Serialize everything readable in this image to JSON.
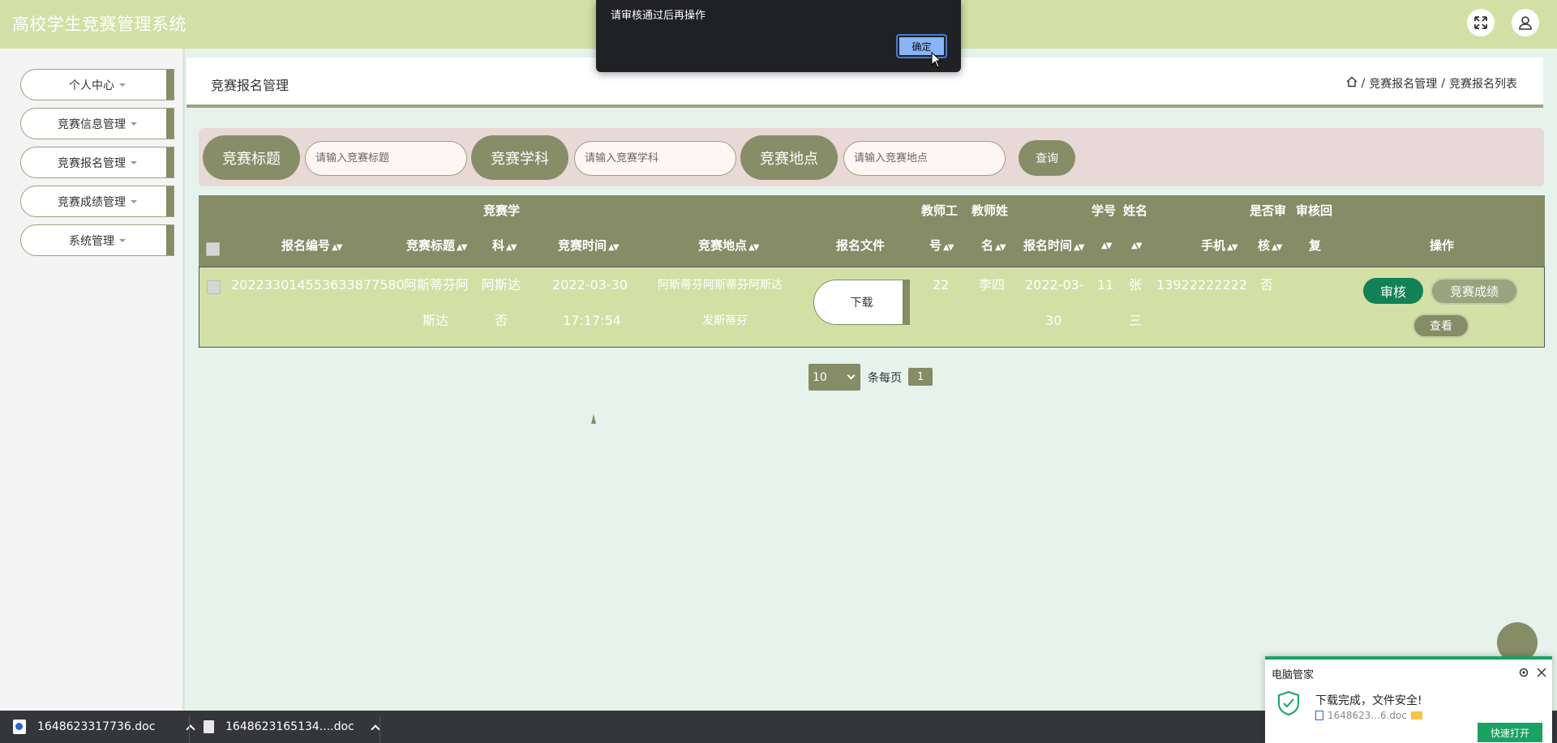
{
  "app": {
    "title": "高校学生竞赛管理系统"
  },
  "header": {
    "fullscreen_icon": "expand-icon",
    "user_icon": "user-icon"
  },
  "sidebar": {
    "items": [
      {
        "label": "个人中心"
      },
      {
        "label": "竞赛信息管理"
      },
      {
        "label": "竞赛报名管理"
      },
      {
        "label": "竞赛成绩管理"
      },
      {
        "label": "系统管理"
      }
    ]
  },
  "page": {
    "title": "竞赛报名管理",
    "breadcrumb": {
      "home_icon": "home-icon",
      "sep": "/",
      "level1": "竞赛报名管理",
      "level2": "竞赛报名列表"
    }
  },
  "search": {
    "title_label": "竞赛标题",
    "title_placeholder": "请输入竞赛标题",
    "subject_label": "竞赛学科",
    "subject_placeholder": "请输入竞赛学科",
    "location_label": "竞赛地点",
    "location_placeholder": "请输入竞赛地点",
    "query_button": "查询"
  },
  "table": {
    "headers": {
      "reg_no": "报名编号",
      "comp_title": "竞赛标题",
      "subject_line1": "竞赛学",
      "subject_line2": "科",
      "comp_time": "竞赛时间",
      "location": "竞赛地点",
      "file": "报名文件",
      "teacher_no_line1": "教师工",
      "teacher_no_line2": "号",
      "teacher_name_line1": "教师姓",
      "teacher_name_line2": "名",
      "reg_time": "报名时间",
      "student_no": "学号",
      "name": "姓名",
      "phone": "手机",
      "approved_line1": "是否审",
      "approved_line2": "核",
      "reply_line1": "审核回",
      "reply_line2": "复",
      "actions": "操作"
    },
    "rows": [
      {
        "reg_no": "20223301455363387758​0",
        "comp_title_1": "阿斯蒂芬阿",
        "comp_title_2": "斯达",
        "subject_1": "阿斯达",
        "subject_2": "否",
        "comp_time_1": "2022-03-30",
        "comp_time_2": "17:17:54",
        "location_1": "阿斯蒂芬阿斯蒂芬阿斯达",
        "location_2": "发斯蒂芬",
        "download": "下载",
        "teacher_no": "22",
        "teacher_name": "李四",
        "reg_time_1": "2022-03-",
        "reg_time_2": "30",
        "student_no": "11",
        "name_1": "张",
        "name_2": "三",
        "phone": "13922222222",
        "approved": "否",
        "reply": "",
        "btn_review": "审核",
        "btn_score": "竞赛成绩",
        "btn_view": "查看"
      }
    ]
  },
  "pagination": {
    "page_size": "10",
    "per_page_label": "条每页",
    "current_page": "1"
  },
  "alert": {
    "message": "请审核通过后再操作",
    "ok": "确定"
  },
  "downloads": [
    {
      "name": "1648623317736.doc"
    },
    {
      "name": "1648623165134....doc"
    }
  ],
  "toast": {
    "title": "电脑管家",
    "message": "下载完成，文件安全!",
    "file": "1648623...6.doc",
    "open_button": "快速打开"
  },
  "colors": {
    "header": "#d2e0a6",
    "accent": "#858c66",
    "review_btn": "#128156",
    "toast_green": "#1aa263"
  }
}
